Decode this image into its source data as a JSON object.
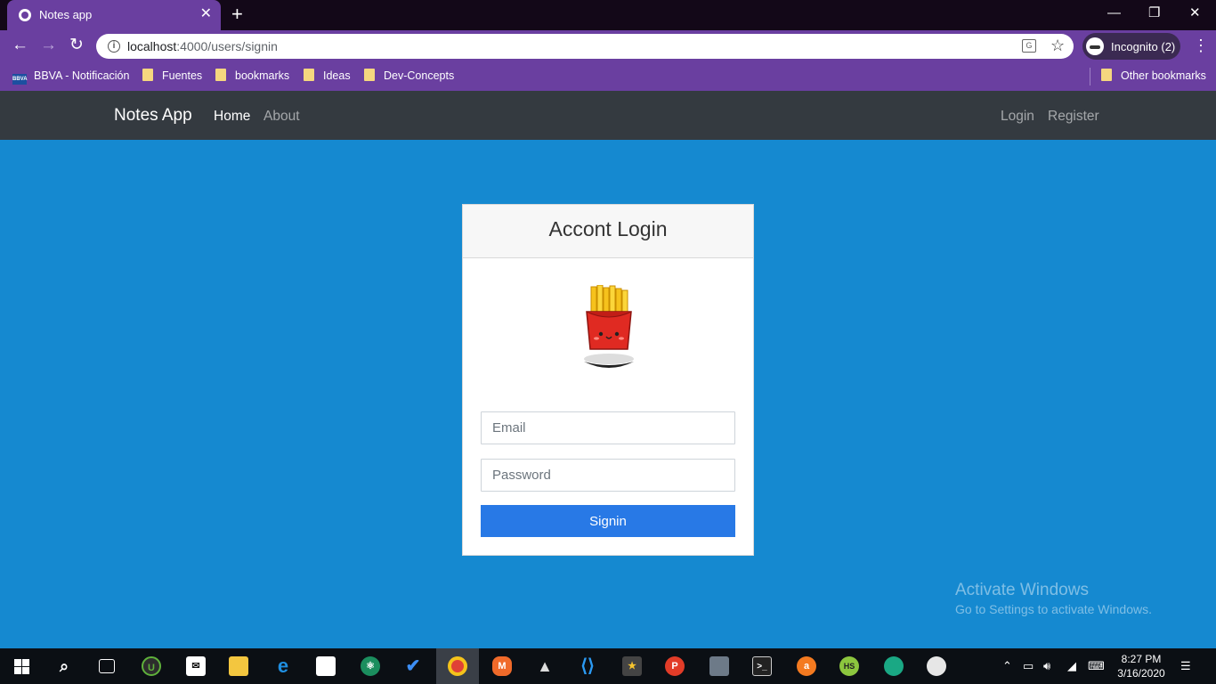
{
  "browser": {
    "tab_title": "Notes app",
    "tab_close": "✕",
    "new_tab": "+",
    "url_host": "localhost",
    "url_path": ":4000/users/signin",
    "incognito_label": "Incognito (2)",
    "window_controls": {
      "minimize": "—",
      "restore": "❐",
      "close": "✕"
    },
    "bookmarks": [
      {
        "label": "BBVA - Notificación",
        "icon": "bbva-icon"
      },
      {
        "label": "Fuentes",
        "icon": "folder-icon"
      },
      {
        "label": "bookmarks",
        "icon": "folder-icon"
      },
      {
        "label": "Ideas",
        "icon": "folder-icon"
      },
      {
        "label": "Dev-Concepts",
        "icon": "folder-icon"
      }
    ],
    "other_bookmarks": "Other bookmarks"
  },
  "navbar": {
    "brand": "Notes App",
    "links": [
      "Home",
      "About"
    ],
    "right_links": [
      "Login",
      "Register"
    ]
  },
  "login": {
    "title": "Accont Login",
    "email_placeholder": "Email",
    "password_placeholder": "Password",
    "submit_label": "Signin",
    "accent_color": "#2879e6"
  },
  "watermark": {
    "title": "Activate Windows",
    "subtitle": "Go to Settings to activate Windows."
  },
  "taskbar": {
    "time": "8:27 PM",
    "date": "3/16/2020"
  },
  "colors": {
    "page_background": "#1589d0",
    "navbar_background": "#343a40",
    "browser_chrome": "#6a3fa0"
  }
}
